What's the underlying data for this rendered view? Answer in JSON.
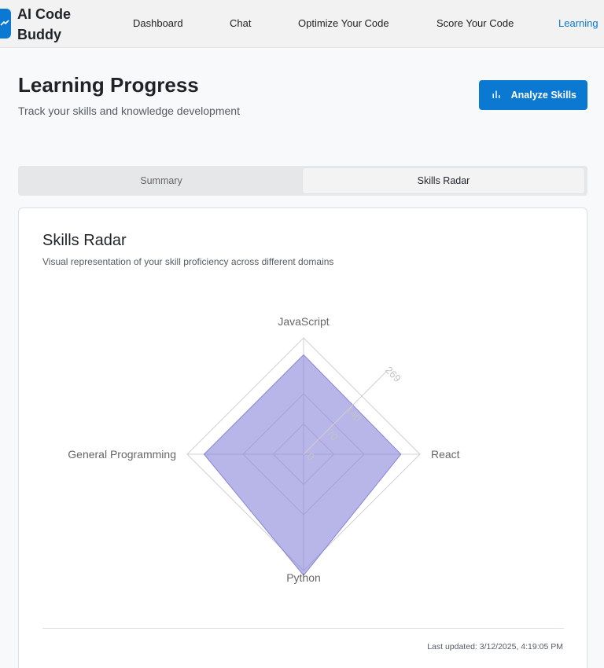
{
  "app": {
    "brand": "AI Code Buddy"
  },
  "nav": {
    "items": [
      {
        "label": "Dashboard"
      },
      {
        "label": "Chat"
      },
      {
        "label": "Optimize Your Code"
      },
      {
        "label": "Score Your Code"
      },
      {
        "label": "Learning",
        "active": true
      }
    ]
  },
  "header": {
    "title": "Learning Progress",
    "subtitle": "Track your skills and knowledge development",
    "analyze_button": "Analyze Skills",
    "analyze_icon": "bar-chart-icon"
  },
  "tabs": [
    {
      "label": "Summary",
      "active": false
    },
    {
      "label": "Skills Radar",
      "active": true
    }
  ],
  "card": {
    "title": "Skills Radar",
    "subtitle": "Visual representation of your skill proficiency across different domains",
    "last_updated": "Last updated: 3/12/2025, 4:19:05 PM"
  },
  "colors": {
    "accent": "#0b78d1",
    "radar_fill": "#8884d8"
  },
  "chart_data": {
    "type": "radar",
    "axes": [
      "JavaScript",
      "React",
      "Python",
      "General Programming"
    ],
    "series": [
      {
        "values": [
          230,
          225,
          280,
          230
        ]
      }
    ],
    "radial_ticks": [
      0,
      70,
      140,
      269
    ],
    "radial_range": [
      0,
      269
    ],
    "grid": true
  }
}
